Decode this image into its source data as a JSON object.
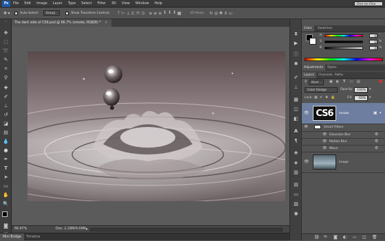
{
  "app": {
    "logo": "Ps"
  },
  "menu": [
    "File",
    "Edit",
    "Image",
    "Layer",
    "Type",
    "Select",
    "Filter",
    "3D",
    "View",
    "Window",
    "Help"
  ],
  "workspace": "One-on-One",
  "options": {
    "auto_select_label": "Auto-Select:",
    "auto_select_value": "Group",
    "show_transform_label": "Show Transform Controls",
    "mode_3d_label": "3D Mode:"
  },
  "document": {
    "tab_title": "The dark side of CS6.psd @ 66.7% (smoke, RGB/8) *",
    "tab_close": "×"
  },
  "status": {
    "zoom": "66.67%",
    "doc_size": "Doc: 2.29M/4.09M"
  },
  "bottom_tabs": [
    "Mini Bridge",
    "Timeline"
  ],
  "color_panel": {
    "tabs": [
      "Color",
      "Swatches"
    ],
    "channels": [
      {
        "label": "H",
        "value": "0",
        "unit": "°"
      },
      {
        "label": "S",
        "value": "0",
        "unit": "%"
      },
      {
        "label": "B",
        "value": "0",
        "unit": "%"
      }
    ]
  },
  "adjustments_panel": {
    "tabs": [
      "Adjustments",
      "Styles"
    ]
  },
  "layers_panel": {
    "tabs": [
      "Layers",
      "Channels",
      "Paths"
    ],
    "filter_kind": "Kind",
    "blend_mode": "Color Dodge",
    "opacity_label": "Opacity:",
    "opacity_value": "100%",
    "lock_label": "Lock:",
    "fill_label": "Fill:",
    "fill_value": "60%",
    "layers": [
      {
        "name": "smoke",
        "thumb_text": "CS6"
      },
      {
        "name": "Smart Filters"
      },
      {
        "name": "Gaussian Blur"
      },
      {
        "name": "Motion Blur"
      },
      {
        "name": "Wave"
      },
      {
        "name": "image"
      }
    ],
    "footer_icons": [
      "link-icon",
      "fx-icon",
      "mask-icon",
      "adjustment-icon",
      "folder-icon",
      "new-layer-icon",
      "trash-icon"
    ]
  },
  "colors": {
    "menubar": "#3a3a3a",
    "panel": "#535353",
    "selected_layer": "#6d7ea0",
    "ps_blue": "#1d5aa8"
  }
}
